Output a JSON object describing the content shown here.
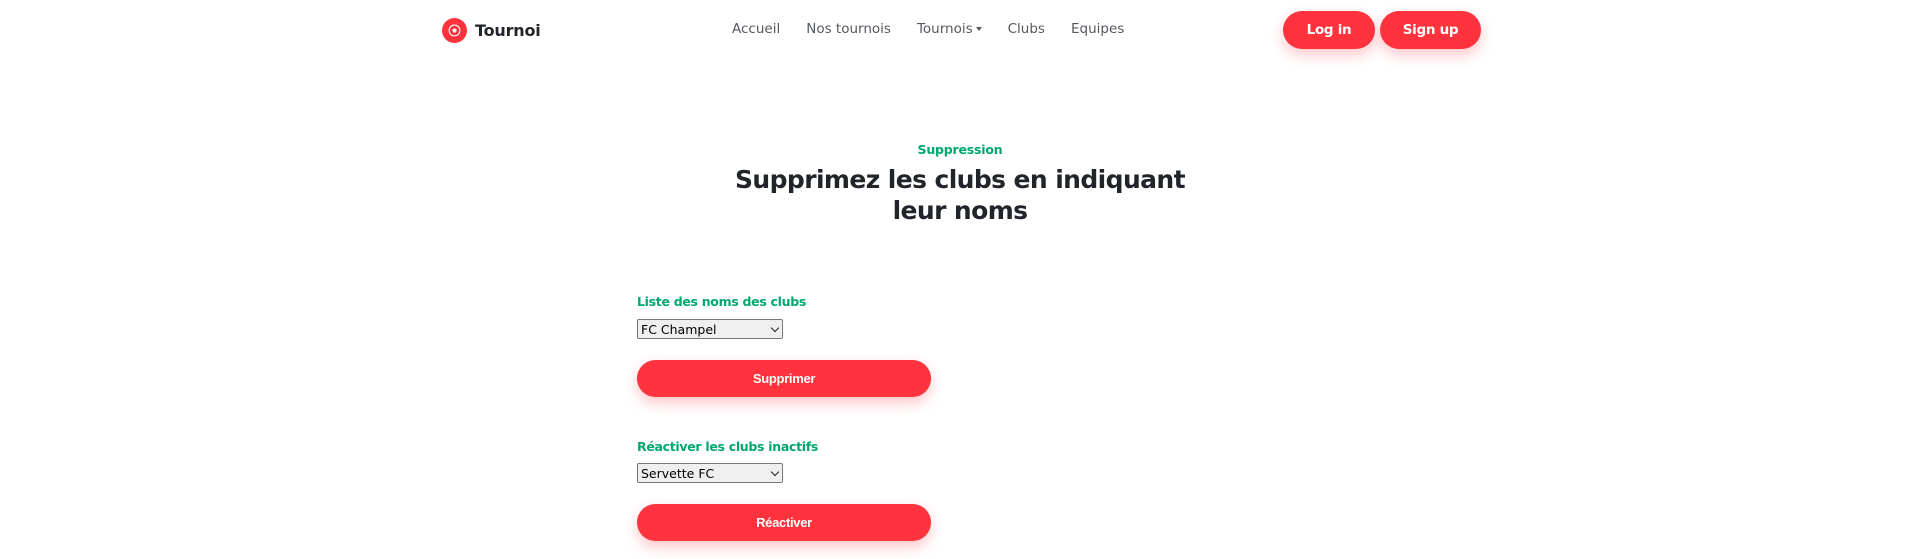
{
  "brand": {
    "name": "Tournoi",
    "icon": "soccer-ball-icon",
    "accent_color": "#ff323d"
  },
  "nav": {
    "items": [
      {
        "label": "Accueil"
      },
      {
        "label": "Nos tournois"
      },
      {
        "label": "Tournois",
        "has_dropdown": true
      },
      {
        "label": "Clubs"
      },
      {
        "label": "Equipes"
      }
    ],
    "login_label": "Log in",
    "signup_label": "Sign up"
  },
  "section": {
    "eyebrow": "Suppression",
    "title": "Supprimez les clubs en indiquant leur noms",
    "eyebrow_color": "#00a86b"
  },
  "delete_form": {
    "label": "Liste des noms des clubs",
    "selected": "FC Champel",
    "button_label": "Supprimer"
  },
  "reactivate_form": {
    "label": "Réactiver les clubs inactifs",
    "selected": "Servette FC",
    "button_label": "Réactiver"
  }
}
